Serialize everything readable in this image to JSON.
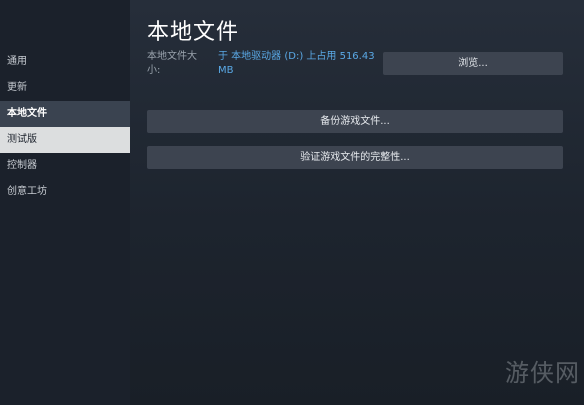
{
  "sidebar": {
    "items": [
      {
        "label": "通用"
      },
      {
        "label": "更新"
      },
      {
        "label": "本地文件"
      },
      {
        "label": "测试版"
      },
      {
        "label": "控制器"
      },
      {
        "label": "创意工坊"
      }
    ]
  },
  "main": {
    "title": "本地文件",
    "size_label": "本地文件大小:",
    "size_value": "于 本地驱动器 (D:) 上占用 516.43 MB",
    "browse_button": "浏览...",
    "backup_button": "备份游戏文件...",
    "verify_button": "验证游戏文件的完整性..."
  },
  "watermark": "游侠网",
  "colors": {
    "accent": "#5aa9e6",
    "active_item": "#3a4350",
    "hover_item": "#dcdedf",
    "button": "#3d4450"
  }
}
